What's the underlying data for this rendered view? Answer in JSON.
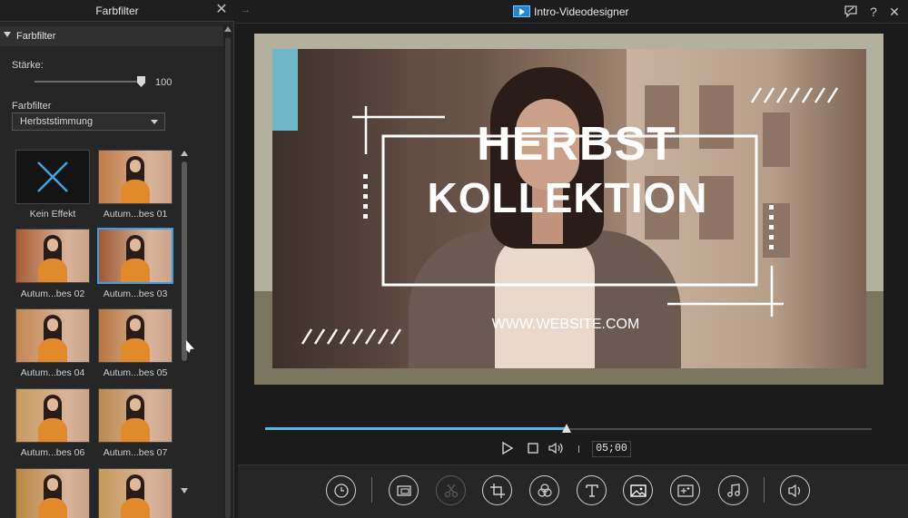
{
  "left_panel": {
    "title": "Farbfilter",
    "section_label": "Farbfilter",
    "strength_label": "Stärke:",
    "strength_value": "100",
    "filter_label": "Farbfilter",
    "filter_dropdown_value": "Herbststimmung",
    "filters": [
      {
        "label": "Kein Effekt",
        "selected": false
      },
      {
        "label": "Autum...bes 01",
        "selected": false
      },
      {
        "label": "Autum...bes 02",
        "selected": false
      },
      {
        "label": "Autum...bes 03",
        "selected": true
      },
      {
        "label": "Autum...bes 04",
        "selected": false
      },
      {
        "label": "Autum...bes 05",
        "selected": false
      },
      {
        "label": "Autum...bes 06",
        "selected": false
      },
      {
        "label": "Autum...bes 07",
        "selected": false
      },
      {
        "label": "",
        "selected": false
      },
      {
        "label": "",
        "selected": false
      }
    ]
  },
  "topbar": {
    "app_title": "Intro-Videodesigner",
    "help_label": "?",
    "close_label": "✕"
  },
  "preview": {
    "headline_1": "HERBST",
    "headline_2": "KOLLEKTION",
    "website": "WWW.WEBSITE.COM"
  },
  "playback": {
    "progress": 0.5,
    "time": "05;00"
  },
  "toolbar_icons": [
    "clock-icon",
    "slides-icon",
    "cut-icon",
    "crop-icon",
    "color-icon",
    "text-icon",
    "image-icon",
    "sparkle-icon",
    "music-icon",
    "volume-icon"
  ],
  "colors": {
    "accent": "#3b9ee8",
    "progress": "#56b8e8",
    "background": "#1b1b1b"
  }
}
